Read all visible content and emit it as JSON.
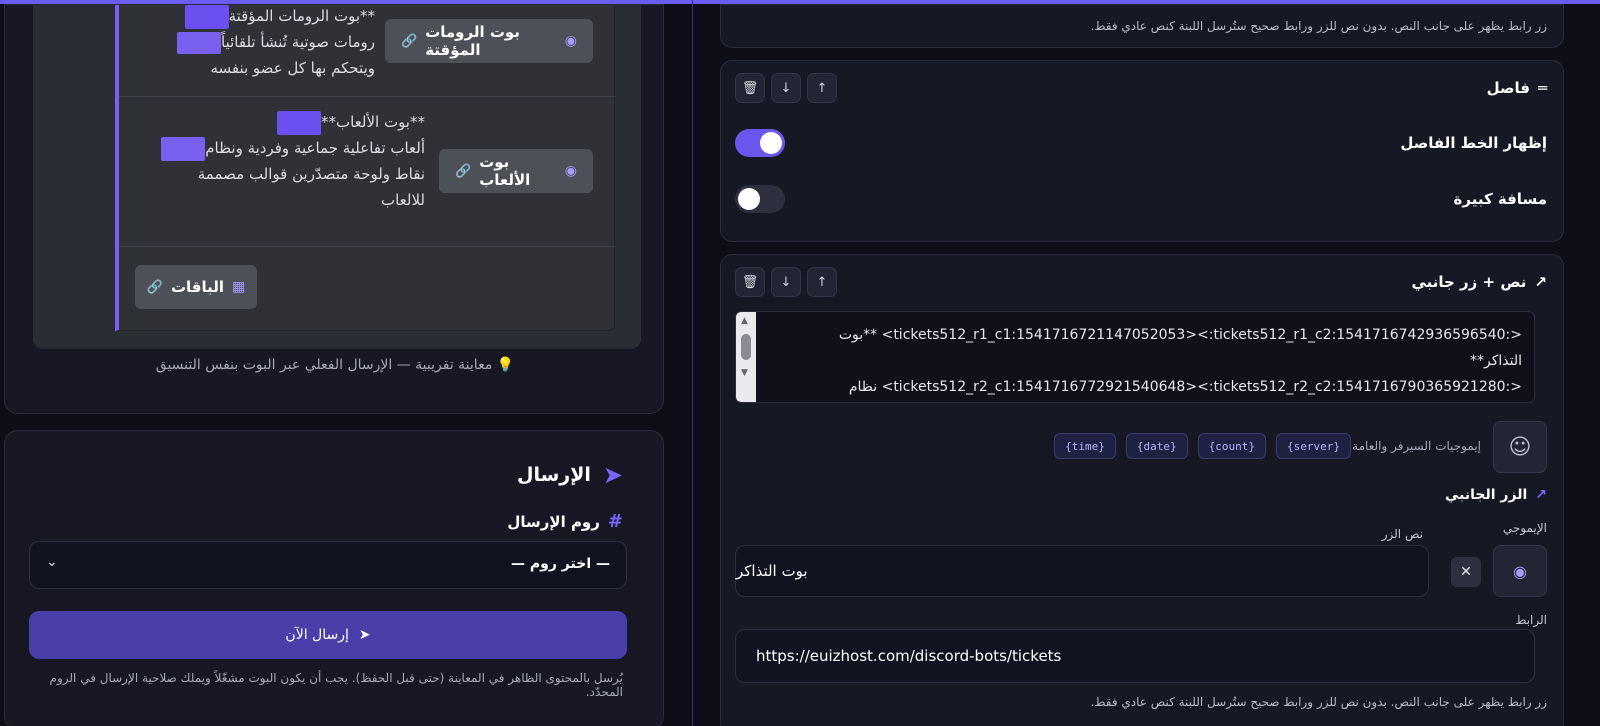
{
  "preview": {
    "row1": {
      "line1_suffix": "**بوت الرومات المؤقتة",
      "line2": "رومات صوتية تُنشأ تلقائياً",
      "line3": "ويتحكم بها كل عضو بنفسه",
      "button_label": "بوت الرومات المؤقتة"
    },
    "row2": {
      "line1": "**بوت الألعاب**",
      "line2": "ألعاب تفاعلية جماعية وفردية ونظام",
      "line3": "نقاط ولوحة متصدّرين قوالب مصممة",
      "line4": "للالعاب",
      "button_label": "بوت الألعاب"
    },
    "packages_button": "الباقات",
    "note": "💡 معاينة تقريبية — الإرسال الفعلي عبر البوت بنفس التنسيق"
  },
  "send": {
    "title": "الإرسال",
    "room_label": "روم الإرسال",
    "room_select_value": "— اختر روم —",
    "send_button": "إرسال الآن",
    "note": "يُرسل بالمحتوى الظاهر في المعاينة (حتى قبل الحفظ). يجب أن يكون البوت مشغّلاً ويملك صلاحية الإرسال في الروم المحدّد."
  },
  "editor": {
    "top_hint": "زر رابط يظهر على جانب النص. بدون نص للزر ورابط صحيح ستُرسل اللبنة كنص عادي فقط.",
    "separator": {
      "title": "فاصل",
      "show_line_label": "إظهار الخط الفاصل",
      "show_line_on": true,
      "large_spacing_label": "مسافة كبيرة",
      "large_spacing_on": false
    },
    "text_button": {
      "title": "نص + زر جانبي",
      "text_line1": "<:tickets512_r1_c1:1541716721147052053><:tickets512_r1_c2:1541716742936596540> **بوت",
      "text_line2": "التذاكر**",
      "text_line3": "<:tickets512_r2_c1:1541716772921540648><:tickets512_r2_c2:1541716790365921280> نظام",
      "emoji_hint": "إيموجيات السيرفر والعامة",
      "chips": [
        "{server}",
        "{count}",
        "{date}",
        "{time}"
      ],
      "side_button_title": "الزر الجانبي",
      "emoji_label": "الإيموجي",
      "button_text_label": "نص الزر",
      "button_text_value": "بوت التذاكر",
      "link_label": "الرابط",
      "link_value": "https://euizhost.com/discord-bots/tickets",
      "bottom_hint": "زر رابط يظهر على جانب النص. بدون نص للزر ورابط صحيح ستُرسل اللبنة كنص عادي فقط."
    }
  },
  "colors": {
    "accent": "#6a57ee",
    "brand_purple": "#7b5cf5",
    "send_button": "#4a3fa8"
  }
}
